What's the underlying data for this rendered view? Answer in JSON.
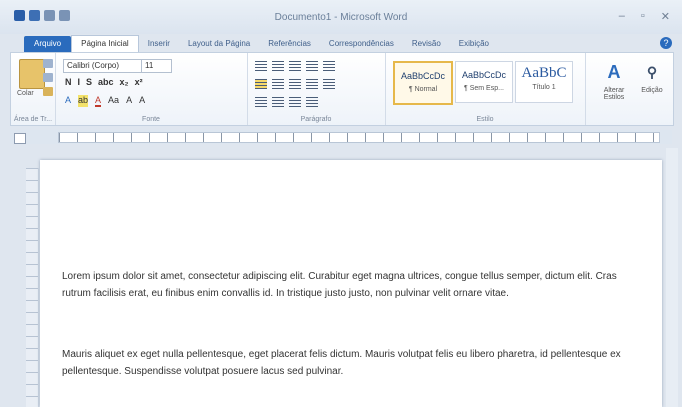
{
  "window": {
    "title": "Documento1 - Microsoft Word"
  },
  "quick_access": [
    "save-icon",
    "undo-icon",
    "redo-icon"
  ],
  "tabs": [
    "Arquivo",
    "Página Inicial",
    "Inserir",
    "Layout da Página",
    "Referências",
    "Correspondências",
    "Revisão",
    "Exibição"
  ],
  "ribbon": {
    "clipboard": {
      "paste_label": "Colar",
      "group_label": "Área de Tr..."
    },
    "font": {
      "name": "Calibri (Corpo)",
      "size": "11",
      "group_label": "Fonte",
      "fmt": [
        "N",
        "I",
        "S",
        "abc",
        "x₂",
        "x²"
      ],
      "fmt2": [
        "A",
        "ab",
        "A",
        "Aa",
        "A",
        "A"
      ]
    },
    "paragraph": {
      "group_label": "Parágrafo"
    },
    "styles": {
      "group_label": "Estilo",
      "items": [
        {
          "preview": "AaBbCcDc",
          "name": "¶ Normal"
        },
        {
          "preview": "AaBbCcDc",
          "name": "¶ Sem Esp..."
        },
        {
          "preview": "AaBbC",
          "name": "Título 1"
        }
      ]
    },
    "editing": {
      "change_styles": "Alterar Estilos",
      "edit_label": "Edição"
    }
  },
  "document": {
    "paragraphs": [
      "Lorem ipsum dolor sit amet, consectetur adipiscing elit. Curabitur eget magna ultrices, congue tellus semper, dictum elit. Cras rutrum facilisis erat, eu finibus enim convallis id. In tristique justo justo, non pulvinar velit ornare vitae.",
      "Mauris aliquet ex eget nulla pellentesque, eget placerat felis dictum. Mauris volutpat felis eu libero pharetra, id pellentesque ex pellentesque. Suspendisse volutpat posuere lacus sed pulvinar."
    ]
  }
}
